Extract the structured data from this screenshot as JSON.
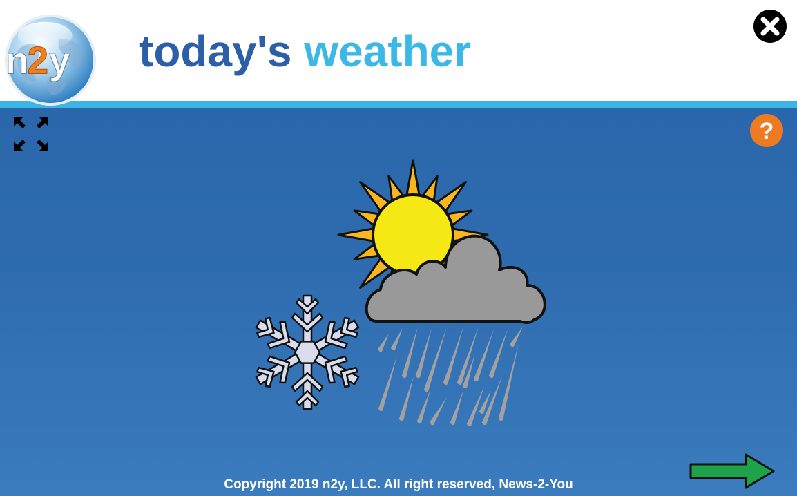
{
  "header": {
    "logo_text": "n2y",
    "title_part1": "today's",
    "title_part2": "weather"
  },
  "controls": {
    "close_icon": "close-x-icon",
    "expand_icon": "fullscreen-expand-icon",
    "help_label": "?",
    "next_icon": "arrow-right-icon"
  },
  "main": {
    "illustration_icon": "sun-cloud-rain-snow-icon"
  },
  "footer": {
    "copyright": "Copyright  2019 n2y, LLC. All right reserved, News-2-You"
  },
  "colors": {
    "header_bg": "#ffffff",
    "title_dark_blue": "#2d5ea8",
    "title_light_blue": "#3bb8e6",
    "stripe": "#3bb6e4",
    "main_bg": "#2f6db0",
    "help_orange": "#ee7a22",
    "next_green": "#1ea24a",
    "logo_orange": "#f07f1b",
    "sun_yellow": "#f6e814",
    "sun_rays": "#f9b71f",
    "cloud_gray": "#9a9a9a",
    "snowflake": "#d9dcec",
    "rain": "#a2a0a0"
  }
}
